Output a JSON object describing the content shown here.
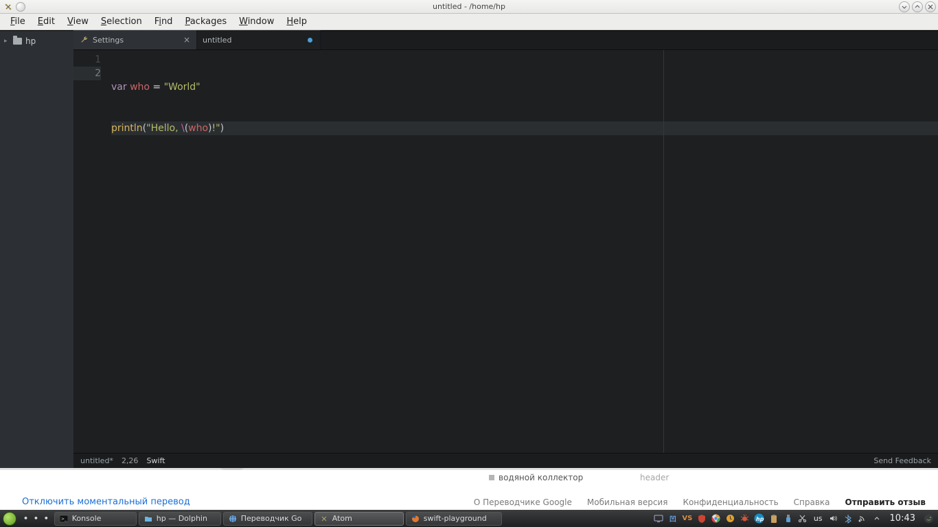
{
  "window": {
    "title": "untitled - /home/hp"
  },
  "menu": {
    "file": "File",
    "edit": "Edit",
    "view": "View",
    "selection": "Selection",
    "find": "Find",
    "packages": "Packages",
    "window": "Window",
    "help": "Help"
  },
  "tree": {
    "root": "hp"
  },
  "tabs": {
    "settings": "Settings",
    "untitled": "untitled"
  },
  "code": {
    "ln1": "1",
    "ln2": "2",
    "l1": {
      "kw": "var",
      "sp1": " ",
      "id": "who",
      "sp2": " ",
      "eq": "=",
      "sp3": " ",
      "str": "\"World\""
    },
    "l2": {
      "fn": "println",
      "po": "(",
      "s1": "\"Hello, ",
      "esc": "\\",
      "po2": "(",
      "id2": "who",
      "pc2": ")",
      "s3": "!\"",
      "pc": ")"
    }
  },
  "status": {
    "file": "untitled*",
    "pos": "2,26",
    "lang": "Swift",
    "feedback": "Send Feedback"
  },
  "browser": {
    "item1": "водяной коллектор",
    "item2": "header",
    "leftlink": "Отключить моментальный перевод",
    "about": "О Переводчике Google",
    "mobile": "Мобильная версия",
    "privacy": "Конфиденциальность",
    "help": "Справка",
    "send": "Отправить отзыв"
  },
  "taskbar": {
    "konsole": "Konsole",
    "dolphin": "hp — Dolphin",
    "translate": "Переводчик Go",
    "atom": "Atom",
    "swift": "swift-playground",
    "lang": "us",
    "time": "10:43"
  }
}
